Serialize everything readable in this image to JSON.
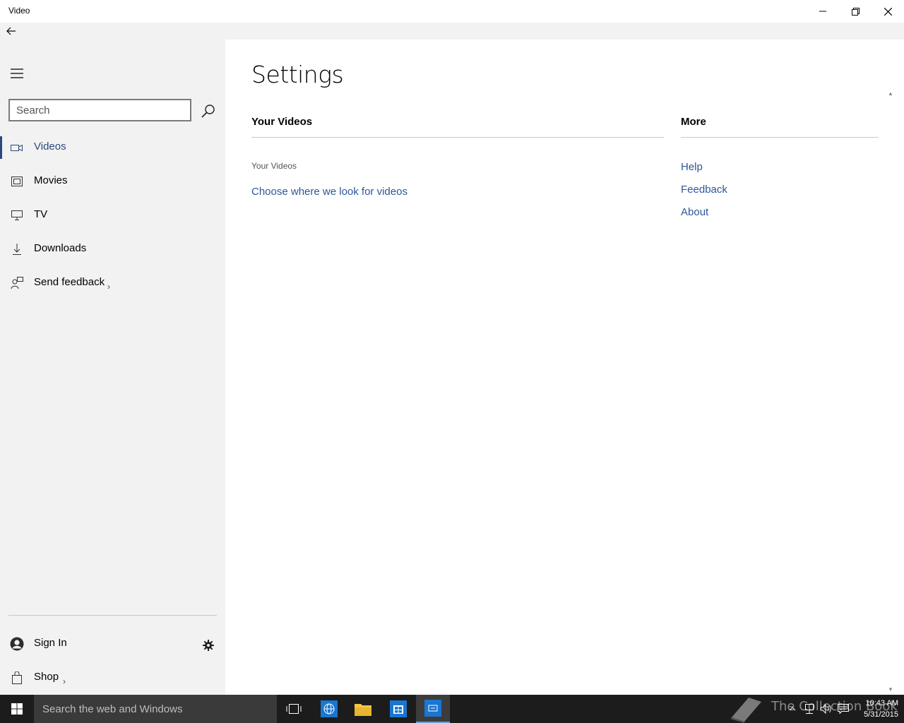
{
  "window": {
    "title": "Video",
    "controls": {
      "minimize": "minimize-icon",
      "restore": "restore-icon",
      "close": "close-icon"
    }
  },
  "sidebar": {
    "search_placeholder": "Search",
    "items": [
      {
        "label": "Videos",
        "icon": "video-camera-icon",
        "active": true
      },
      {
        "label": "Movies",
        "icon": "film-icon"
      },
      {
        "label": "TV",
        "icon": "monitor-icon"
      },
      {
        "label": "Downloads",
        "icon": "download-icon"
      },
      {
        "label": "Send feedback",
        "icon": "feedback-icon",
        "chevron": "›"
      }
    ],
    "bottom": {
      "sign_in": "Sign In",
      "shop": "Shop",
      "shop_chevron": "›"
    }
  },
  "main": {
    "title": "Settings",
    "your_videos": {
      "heading": "Your Videos",
      "sublabel": "Your Videos",
      "link": "Choose where we look for videos"
    },
    "more": {
      "heading": "More",
      "links": [
        "Help",
        "Feedback",
        "About"
      ]
    }
  },
  "taskbar": {
    "search_text": "Search the web and Windows",
    "watermark": "The Collection Book",
    "time": "10:43 AM",
    "date": "5/31/2015"
  },
  "colors": {
    "accent": "#2b4a7c",
    "link": "#2b5797",
    "sidebar_bg": "#f2f2f2",
    "taskbar_bg": "#1c1c1c"
  }
}
